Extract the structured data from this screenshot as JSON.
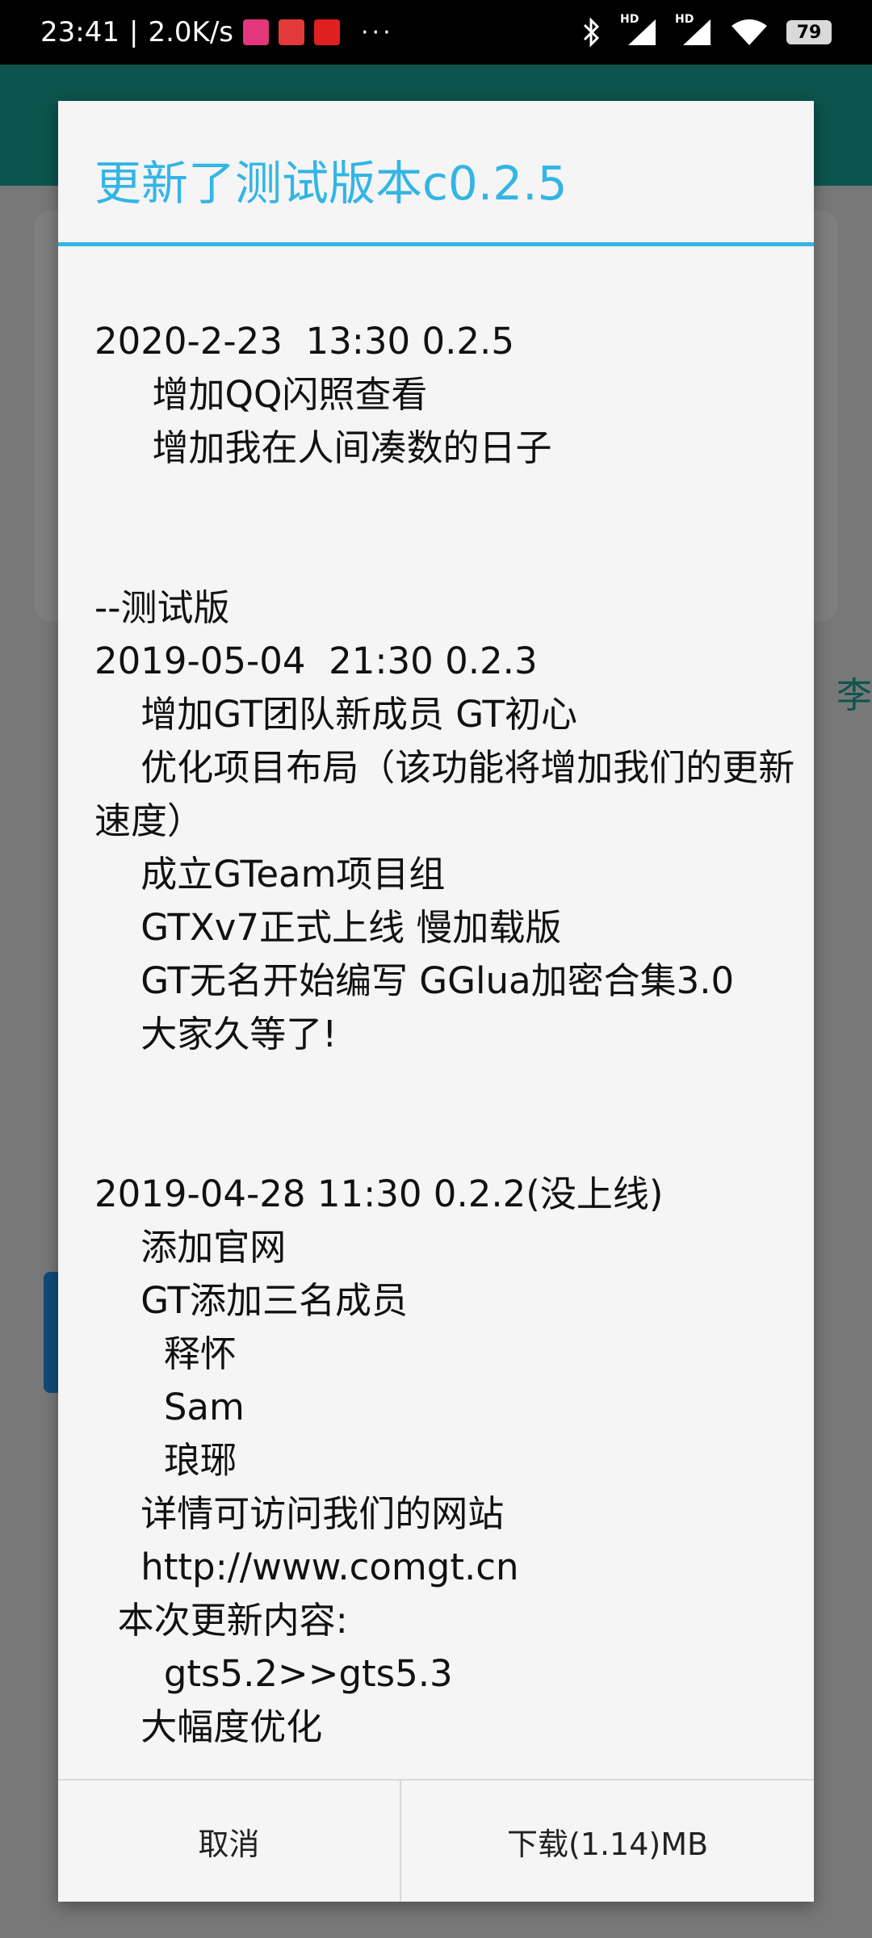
{
  "status_bar": {
    "time": "23:41",
    "speed": "2.0K/s",
    "dots": "···",
    "hd1": "HD",
    "hd2": "HD",
    "battery": "79"
  },
  "dialog": {
    "title": "更新了测试版本c0.2.5",
    "changelog": "2020-2-23  13:30 0.2.5\n     增加QQ闪照查看\n     增加我在人间凑数的日子\n\n\n--测试版\n2019-05-04  21:30 0.2.3\n    增加GT团队新成员 GT初心\n    优化项目布局（该功能将增加我们的更新速度）\n    成立GTeam项目组\n    GTXv7正式上线 慢加载版\n    GT无名开始编写 GGlua加密合集3.0\n    大家久等了!\n\n\n2019-04-28 11:30 0.2.2(没上线)\n    添加官网\n    GT添加三名成员\n      释怀\n      Sam\n      琅琊\n    详情可访问我们的网站\n    http://www.comgt.cn\n  本次更新内容:\n      gts5.2>>gts5.3\n    大幅度优化",
    "cancel_label": "取消",
    "download_label": "下载(1.14)MB"
  },
  "background": {
    "side_text": "李"
  },
  "colors": {
    "accent": "#33b5e5",
    "toolbar": "#18a89a"
  }
}
